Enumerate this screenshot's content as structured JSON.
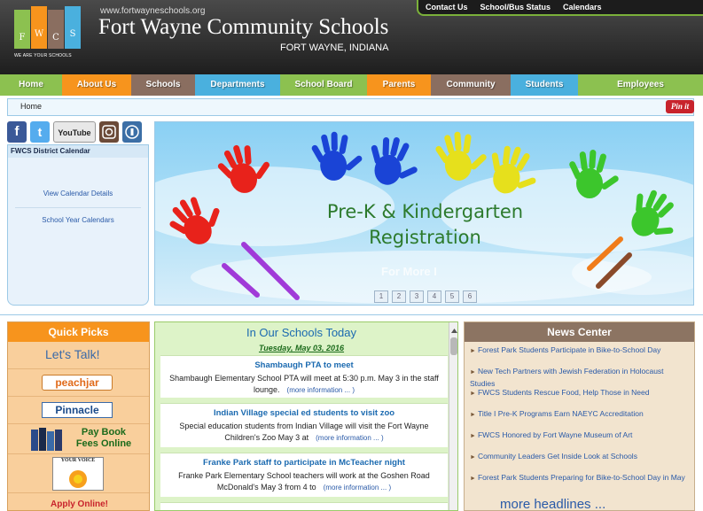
{
  "header": {
    "site_url": "www.fortwayneschools.org",
    "title": "Fort Wayne Community Schools",
    "subtitle": "FORT WAYNE, INDIANA",
    "logo_letters": [
      "F",
      "W",
      "C",
      "S"
    ],
    "logo_tagline": "WE ARE YOUR SCHOOLS",
    "top_links": [
      "Contact Us",
      "School/Bus Status",
      "Calendars"
    ]
  },
  "nav": {
    "items": [
      {
        "label": "Home",
        "color": "#8cc150"
      },
      {
        "label": "About Us",
        "color": "#f7941d"
      },
      {
        "label": "Schools",
        "color": "#8a6e60"
      },
      {
        "label": "Departments",
        "color": "#4ab0de"
      },
      {
        "label": "School Board",
        "color": "#8cc150"
      },
      {
        "label": "Parents",
        "color": "#f7941d"
      },
      {
        "label": "Community",
        "color": "#8a6e60"
      },
      {
        "label": "Students",
        "color": "#4ab0de"
      },
      {
        "label": "Employees",
        "color": "#8cc150"
      }
    ]
  },
  "breadcrumb": "Home",
  "pinit": "Pin it",
  "social": {
    "facebook": "f",
    "twitter": "t",
    "youtube": "YouTube",
    "instagram": "",
    "other": ""
  },
  "calendar": {
    "title": "FWCS District Calendar",
    "links": [
      "View Calendar Details",
      "School Year Calendars"
    ]
  },
  "banner": {
    "title": "Pre-K & Kindergarten\nRegistration",
    "more_info": "For More I",
    "pages": [
      "1",
      "2",
      "3",
      "4",
      "5",
      "6"
    ],
    "hand_colors": [
      "#e8221b",
      "#e8221b",
      "#1a44d6",
      "#1a44d6",
      "#e6e01c",
      "#e6e01c",
      "#3cc62c",
      "#3cc62c"
    ]
  },
  "quick_picks": {
    "title": "Quick Picks",
    "lets_talk": "Let's Talk!",
    "peachjar": "peachjar",
    "pinnacle": "Pinnacle",
    "pay_book": "Pay Book",
    "fees_online": "Fees Online",
    "your_voice": "YOUR VOICE",
    "apply_online": "Apply Online!"
  },
  "schools_today": {
    "title": "In Our Schools Today",
    "date": "Tuesday, May 03, 2016",
    "stories": [
      {
        "title": "Shambaugh PTA to meet",
        "body": "Shambaugh Elementary School PTA will meet at 5:30 p.m. May 3 in the staff lounge.",
        "more": "(more information ... )"
      },
      {
        "title": "Indian Village special ed students to visit zoo",
        "body": "Special education students from Indian Village will visit the Fort Wayne Children's Zoo May 3 at",
        "more": "(more information ... )"
      },
      {
        "title": "Franke Park staff to participate in McTeacher night",
        "body": "Franke Park Elementary School teachers will work at the Goshen Road McDonald's May 3 from 4 to",
        "more": "(more information ... )"
      }
    ]
  },
  "news": {
    "title": "News Center",
    "items": [
      "Forest Park Students Participate in Bike-to-School Day",
      "New Tech Partners with Jewish Federation in Holocaust Studies",
      "FWCS Students Rescue Food, Help Those in Need",
      "Title I Pre-K Programs Earn NAEYC Accreditation",
      "FWCS Honored by Fort Wayne Museum of Art",
      "Community Leaders Get Inside Look at Schools",
      "Forest Park Students Preparing for Bike-to-School Day in May"
    ],
    "more": "more headlines ..."
  }
}
